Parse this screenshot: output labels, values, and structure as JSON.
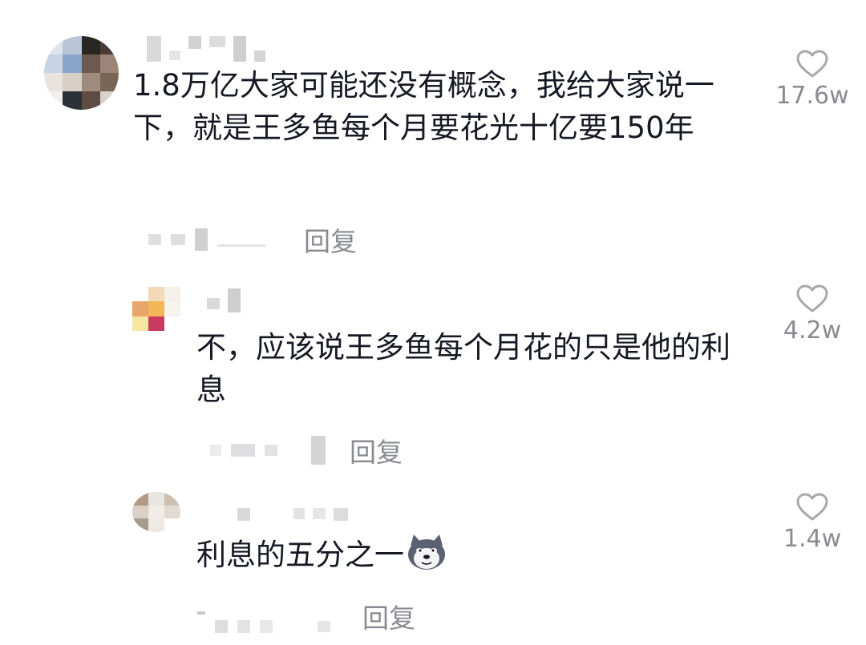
{
  "comments": [
    {
      "text": "1.8万亿大家可能还没有概念，我给大家说一下，就是王多鱼每个月要花光十亿要150年",
      "likes": "17.6w",
      "reply_label": "回复"
    },
    {
      "text": "不，应该说王多鱼每个月花的只是他的利息",
      "likes": "4.2w",
      "reply_label": "回复"
    },
    {
      "text": "利息的五分之一",
      "likes": "1.4w",
      "reply_label": "回复"
    }
  ],
  "icons": {
    "like": "heart-outline-icon",
    "emoji": "doge-emoji-icon"
  },
  "colors": {
    "text": "#161823",
    "secondary": "#8a8b91",
    "heart": "#a9a9ad"
  }
}
